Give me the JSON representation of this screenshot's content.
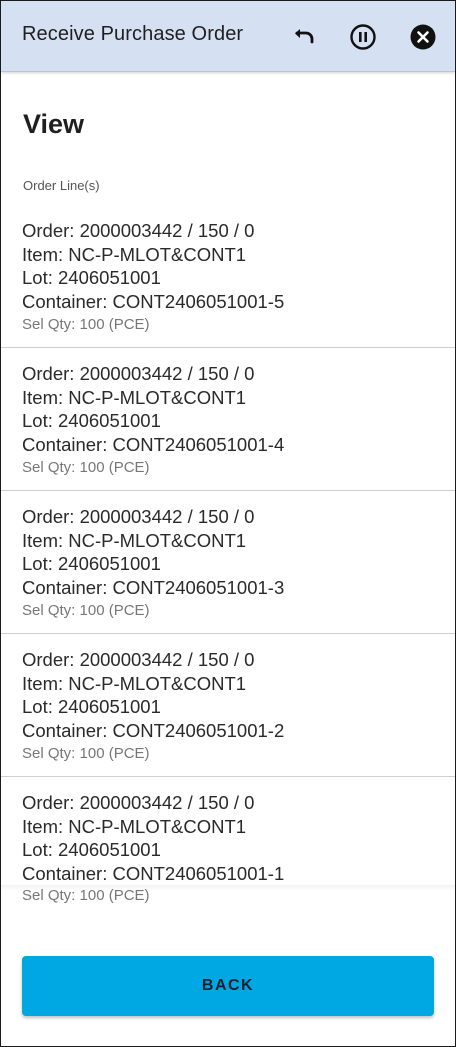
{
  "appbar": {
    "title": "Receive Purchase Order",
    "icons": [
      "undo-icon",
      "pause-circle-icon",
      "close-circle-icon"
    ]
  },
  "view": {
    "title": "View",
    "section_label": "Order Line(s)"
  },
  "order_lines": [
    {
      "order": "Order: 2000003442 / 150 / 0",
      "item": "Item: NC-P-MLOT&CONT1",
      "lot": "Lot: 2406051001",
      "container": "Container: CONT2406051001-5",
      "qty": "Sel Qty: 100 (PCE)"
    },
    {
      "order": "Order: 2000003442 / 150 / 0",
      "item": "Item: NC-P-MLOT&CONT1",
      "lot": "Lot: 2406051001",
      "container": "Container: CONT2406051001-4",
      "qty": "Sel Qty: 100 (PCE)"
    },
    {
      "order": "Order: 2000003442 / 150 / 0",
      "item": "Item: NC-P-MLOT&CONT1",
      "lot": "Lot: 2406051001",
      "container": "Container: CONT2406051001-3",
      "qty": "Sel Qty: 100 (PCE)"
    },
    {
      "order": "Order: 2000003442 / 150 / 0",
      "item": "Item: NC-P-MLOT&CONT1",
      "lot": "Lot: 2406051001",
      "container": "Container: CONT2406051001-2",
      "qty": "Sel Qty: 100 (PCE)"
    },
    {
      "order": "Order: 2000003442 / 150 / 0",
      "item": "Item: NC-P-MLOT&CONT1",
      "lot": "Lot: 2406051001",
      "container": "Container: CONT2406051001-1",
      "qty": "Sel Qty: 100 (PCE)"
    }
  ],
  "footer": {
    "back_label": "BACK"
  },
  "colors": {
    "appbar_bg": "#d5e1f2",
    "accent": "#00a8e3"
  }
}
